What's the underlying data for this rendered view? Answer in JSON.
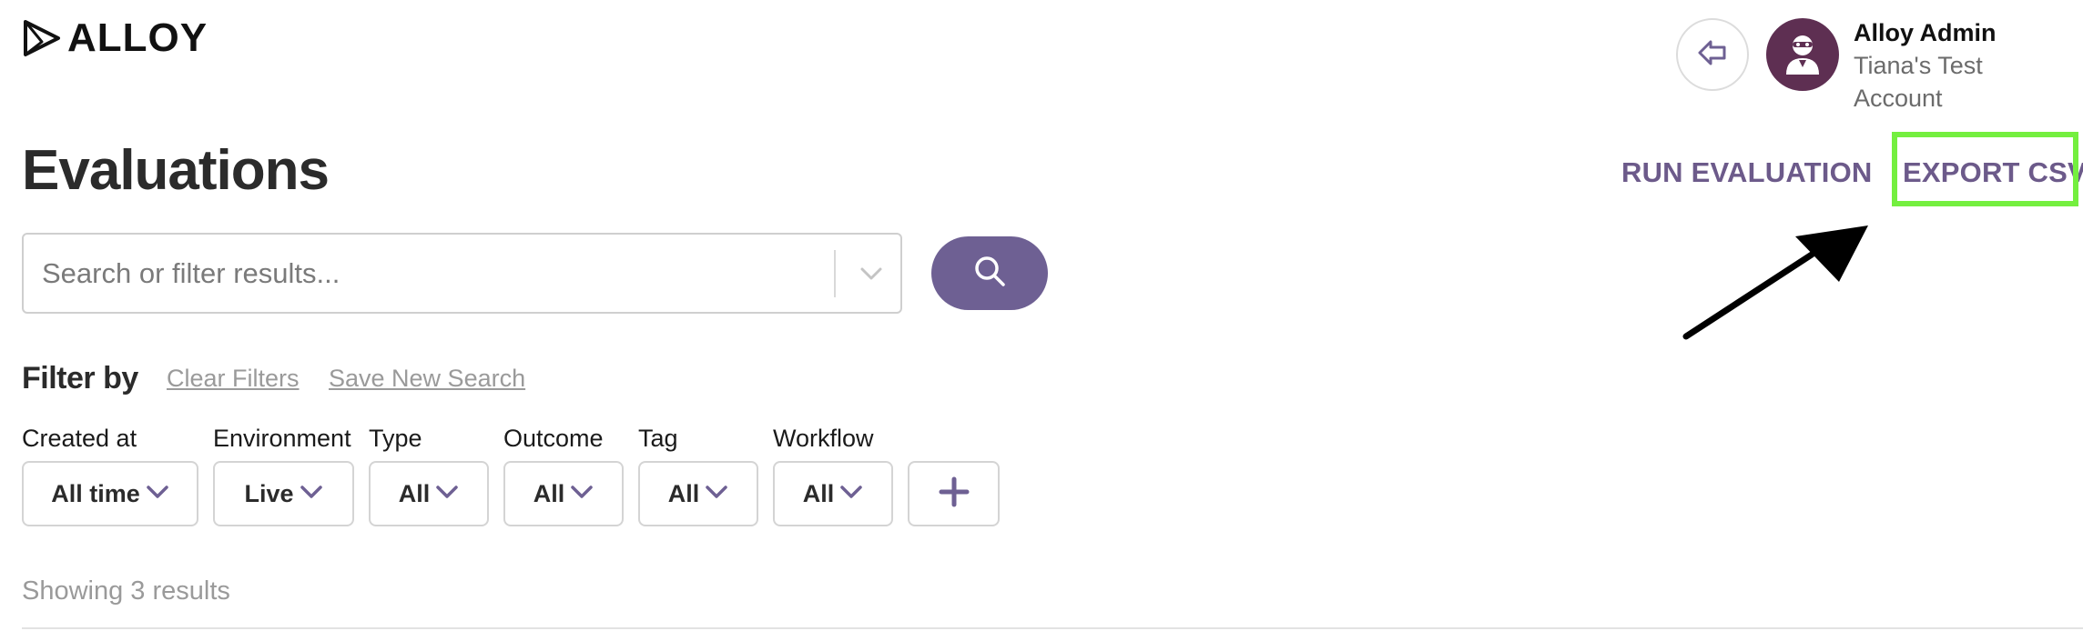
{
  "brand": {
    "name": "ALLOY",
    "logo_icon": "triangle-logo-icon"
  },
  "header": {
    "back_icon": "arrow-left-icon",
    "user_name": "Alloy Admin",
    "account_name": "Tiana's Test Account",
    "avatar_icon": "user-avatar-icon"
  },
  "page": {
    "title": "Evaluations"
  },
  "actions": {
    "run_evaluation": "RUN EVALUATION",
    "export_csv": "EXPORT CSV"
  },
  "search": {
    "placeholder": "Search or filter results...",
    "value": "",
    "dropdown_icon": "chevron-down-icon",
    "button_icon": "search-icon"
  },
  "filters": {
    "heading": "Filter by",
    "clear_label": "Clear Filters",
    "save_label": "Save New Search",
    "groups": [
      {
        "label": "Created at",
        "value": "All time"
      },
      {
        "label": "Environment",
        "value": "Live"
      },
      {
        "label": "Type",
        "value": "All"
      },
      {
        "label": "Outcome",
        "value": "All"
      },
      {
        "label": "Tag",
        "value": "All"
      },
      {
        "label": "Workflow",
        "value": "All"
      }
    ],
    "add_icon": "plus-icon"
  },
  "results": {
    "summary": "Showing 3 results"
  },
  "colors": {
    "accent": "#6e6093",
    "link": "#6c5a8a",
    "highlight": "#74ef3f",
    "avatar_bg": "#5e2f52"
  }
}
